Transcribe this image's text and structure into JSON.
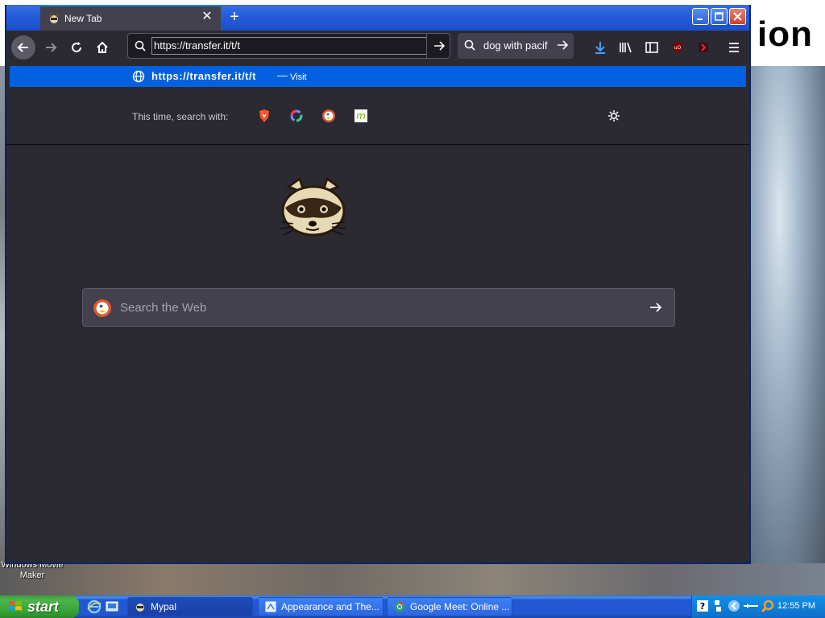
{
  "desktop": {
    "brand_fragment": "ion",
    "icon_label": "Windows Movie Maker"
  },
  "window": {
    "tab_title": "New Tab",
    "new_tab_symbol": "+",
    "close_tab_symbol": "✕"
  },
  "toolbar": {
    "url_value": "https://transfer.it/t/t",
    "search_value": "dog with pacif"
  },
  "dropdown": {
    "suggestion_url": "https://transfer.it/t/t",
    "suggestion_dash": "—",
    "suggestion_action": "Visit",
    "search_with_label": "This time, search with:",
    "engines": [
      "brave-icon",
      "qwant-icon",
      "duckduckgo-icon",
      "mojeek-icon"
    ]
  },
  "content": {
    "search_placeholder": "Search the Web"
  },
  "taskbar": {
    "start_label": "start",
    "tasks": [
      {
        "label": "Mypal",
        "active": true
      },
      {
        "label": "Appearance and The..."
      },
      {
        "label": "Google Meet: Online ..."
      }
    ],
    "clock": "12:55 PM"
  },
  "colors": {
    "accent": "#0060df",
    "browser_bg": "#2b2a33",
    "xp_blue": "#245edb",
    "start_green": "#3c9c3c"
  }
}
